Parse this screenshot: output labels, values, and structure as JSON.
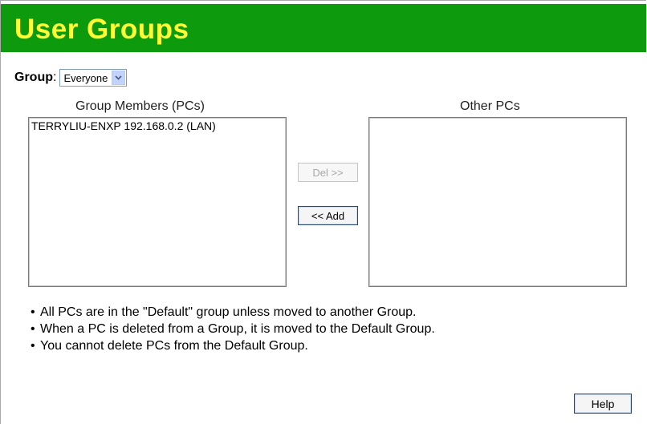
{
  "page": {
    "title": "User Groups"
  },
  "group": {
    "label": "Group",
    "colon": ":",
    "selected": "Everyone"
  },
  "members": {
    "title": "Group Members (PCs)",
    "items": [
      "TERRYLIU-ENXP 192.168.0.2 (LAN)"
    ]
  },
  "others": {
    "title": "Other PCs",
    "items": []
  },
  "buttons": {
    "del": "Del >>",
    "add": "<< Add",
    "help": "Help"
  },
  "notes": [
    "All PCs are in the \"Default\" group unless moved to another Group.",
    "When a PC is deleted from a Group, it is moved to the Default Group.",
    "You cannot delete PCs from the Default Group."
  ],
  "icons": {
    "dropdown": "chevron-down-icon"
  },
  "colors": {
    "banner": "#0d9a0d",
    "title_text": "#ffff33"
  }
}
